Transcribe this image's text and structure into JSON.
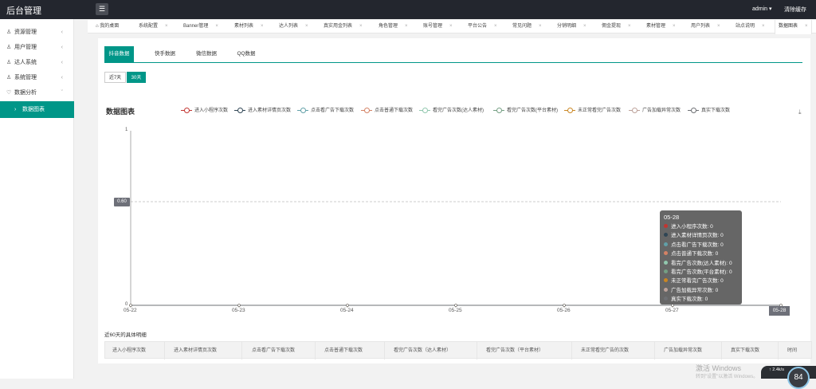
{
  "topbar": {
    "logo": "后台管理",
    "menu_icon": "☰",
    "user": "admin ▾",
    "clear_cache": "清除缓存"
  },
  "sidebar": {
    "items": [
      {
        "label": "资源管理",
        "icon": "resource-icon"
      },
      {
        "label": "用户管理",
        "icon": "user-icon"
      },
      {
        "label": "达人系统",
        "icon": "users-icon"
      },
      {
        "label": "系统管理",
        "icon": "system-icon"
      },
      {
        "label": "数据分析",
        "icon": "analytics-icon"
      },
      {
        "label": "数据图表",
        "icon": "chevron-right-icon",
        "active": true
      }
    ]
  },
  "tabs": [
    {
      "label": "我的桌面"
    },
    {
      "label": "系统配置"
    },
    {
      "label": "Banner管理"
    },
    {
      "label": "素材列表"
    },
    {
      "label": "达人列表"
    },
    {
      "label": "真实用金列表"
    },
    {
      "label": "角色管理"
    },
    {
      "label": "账号管理"
    },
    {
      "label": "平台公告"
    },
    {
      "label": "常见问题"
    },
    {
      "label": "分销明细"
    },
    {
      "label": "佣金提现"
    },
    {
      "label": "素材管理"
    },
    {
      "label": "用户列表"
    },
    {
      "label": "站点说明"
    },
    {
      "label": "数据图表",
      "active": true
    }
  ],
  "sub_tabs": [
    {
      "label": "抖音数据",
      "active": true
    },
    {
      "label": "快手数据"
    },
    {
      "label": "微信数据"
    },
    {
      "label": "QQ数据"
    }
  ],
  "range_buttons": [
    {
      "label": "近7天"
    },
    {
      "label": "30天",
      "active": true
    }
  ],
  "chart_title": "数据图表",
  "chart_data": {
    "type": "line",
    "title": "数据图表",
    "categories": [
      "05-22",
      "05-23",
      "05-24",
      "05-25",
      "05-26",
      "05-27",
      "05-28"
    ],
    "ylim": [
      0,
      1
    ],
    "y_ticks": [
      "1",
      "0"
    ],
    "cursor_y_label": "0.60",
    "cursor_x_label": "05-28",
    "legend_position": "top",
    "series": [
      {
        "name": "进入小程序次数",
        "color": "#c23531",
        "values": [
          0,
          0,
          0,
          0,
          0,
          0,
          0
        ]
      },
      {
        "name": "进入素材详情页次数",
        "color": "#2f4554",
        "values": [
          0,
          0,
          0,
          0,
          0,
          0,
          0
        ]
      },
      {
        "name": "点击看广告下载次数",
        "color": "#61a0a8",
        "values": [
          0,
          0,
          0,
          0,
          0,
          0,
          0
        ]
      },
      {
        "name": "点击普通下载次数",
        "color": "#d48265",
        "values": [
          0,
          0,
          0,
          0,
          0,
          0,
          0
        ]
      },
      {
        "name": "看完广告次数(达人素材)",
        "color": "#91c7ae",
        "values": [
          0,
          0,
          0,
          0,
          0,
          0,
          0
        ]
      },
      {
        "name": "看完广告次数(平台素材)",
        "color": "#749f83",
        "values": [
          0,
          0,
          0,
          0,
          0,
          0,
          0
        ]
      },
      {
        "name": "未正常看完广告次数",
        "color": "#ca8622",
        "values": [
          0,
          0,
          0,
          0,
          0,
          0,
          0
        ]
      },
      {
        "name": "广告加载异常次数",
        "color": "#bda29a",
        "values": [
          0,
          0,
          0,
          0,
          0,
          0,
          0
        ]
      },
      {
        "name": "真实下载次数",
        "color": "#6e7074",
        "values": [
          0,
          0,
          0,
          0,
          0,
          0,
          0
        ]
      }
    ]
  },
  "tooltip": {
    "date": "05-28",
    "rows": [
      {
        "label": "进入小程序次数: 0",
        "color": "#c23531"
      },
      {
        "label": "进入素材详情页次数: 0",
        "color": "#2f4554"
      },
      {
        "label": "点击看广告下载次数: 0",
        "color": "#61a0a8"
      },
      {
        "label": "点击普通下载次数: 0",
        "color": "#d48265"
      },
      {
        "label": "看完广告次数(达人素材): 0",
        "color": "#91c7ae"
      },
      {
        "label": "看完广告次数(平台素材): 0",
        "color": "#749f83"
      },
      {
        "label": "未正常看完广告次数: 0",
        "color": "#ca8622"
      },
      {
        "label": "广告加载异常次数: 0",
        "color": "#bda29a"
      },
      {
        "label": "真实下载次数: 0",
        "color": "#6e7074"
      }
    ]
  },
  "summary": {
    "title": "近60天的具体明细",
    "columns": [
      "进入小程序次数",
      "进入素材详情页次数",
      "点击看广告下载次数",
      "点击普通下载次数",
      "看完广告次数（达人素材）",
      "看完广告次数（平台素材）",
      "未正常看完广告的次数",
      "广告加载异常次数",
      "真实下载次数",
      "时间"
    ]
  },
  "system": {
    "watermark": "激活 Windows",
    "watermark_sub": "转到\"设置\"以激活 Windows。",
    "widget_text": "↑ 2.4k/s",
    "widget_value": "84"
  }
}
